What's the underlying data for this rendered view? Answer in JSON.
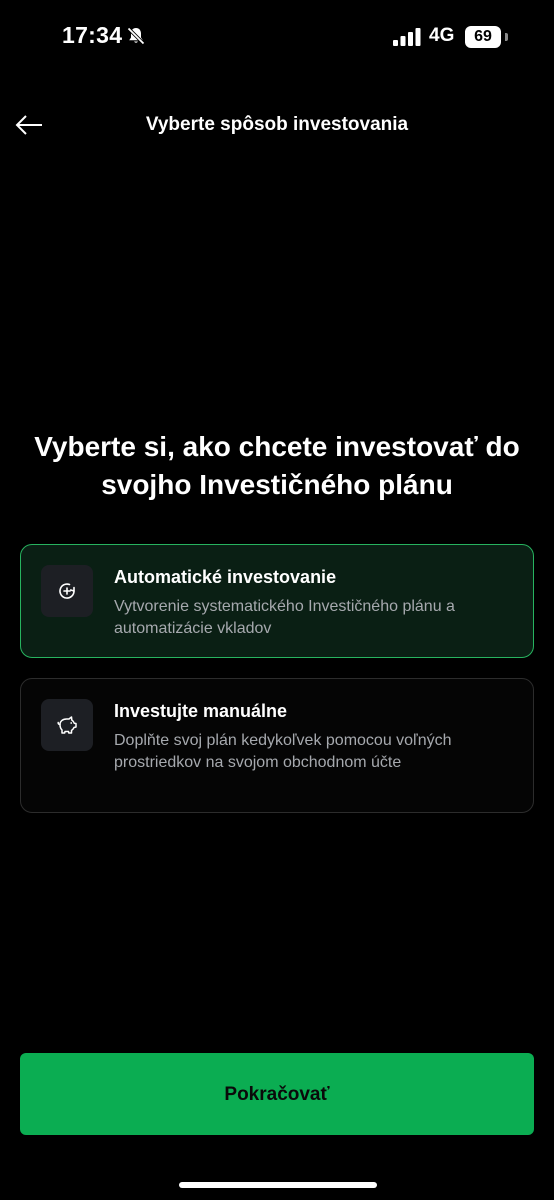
{
  "status_bar": {
    "time": "17:34",
    "network": "4G",
    "battery": "69"
  },
  "header": {
    "title": "Vyberte spôsob investovania"
  },
  "main": {
    "heading": "Vyberte si, ako chcete investovať do svojho Investičného plánu"
  },
  "options": [
    {
      "title": "Automatické investovanie",
      "description": "Vytvorenie systematického Investičného plánu a automatizácie vkladov",
      "selected": true,
      "icon": "auto-invest-icon"
    },
    {
      "title": "Investujte manuálne",
      "description": "Doplňte svoj plán kedykoľvek pomocou voľných prostriedkov na svojom obchodnom účte",
      "selected": false,
      "icon": "piggy-bank-icon"
    }
  ],
  "footer": {
    "continue_label": "Pokračovať"
  },
  "colors": {
    "accent": "#0bad52",
    "selected_border": "#27b35f",
    "background": "#000000"
  }
}
